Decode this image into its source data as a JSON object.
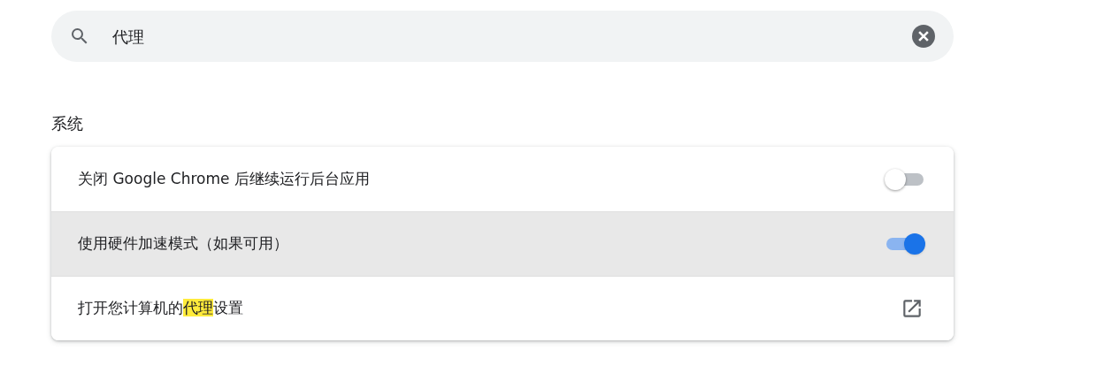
{
  "search": {
    "value": "代理"
  },
  "section": {
    "title": "系统"
  },
  "rows": [
    {
      "kind": "toggle",
      "label_parts": [
        {
          "text": "关闭 Google Chrome 后继续运行后台应用",
          "highlighted": false
        }
      ],
      "on": false,
      "hovered": false
    },
    {
      "kind": "toggle",
      "label_parts": [
        {
          "text": "使用硬件加速模式（如果可用）",
          "highlighted": false
        }
      ],
      "on": true,
      "hovered": true
    },
    {
      "kind": "link",
      "label_parts": [
        {
          "text": "打开您计算机的",
          "highlighted": false
        },
        {
          "text": "代理",
          "highlighted": true
        },
        {
          "text": "设置",
          "highlighted": false
        }
      ],
      "hovered": false
    }
  ]
}
